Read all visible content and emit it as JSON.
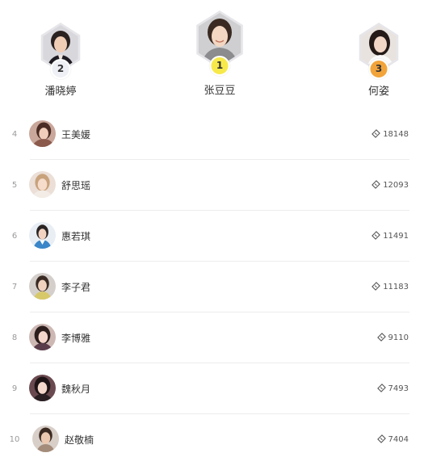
{
  "podium": [
    {
      "rank": "2",
      "name": "潘晓婷",
      "medal_color": "#eef0f6"
    },
    {
      "rank": "1",
      "name": "张豆豆",
      "medal_color": "#f7e94a"
    },
    {
      "rank": "3",
      "name": "何姿",
      "medal_color": "#f2a43a"
    }
  ],
  "ranking": [
    {
      "rank": "4",
      "name": "王美媛",
      "score": "18148"
    },
    {
      "rank": "5",
      "name": "舒思瑶",
      "score": "12093"
    },
    {
      "rank": "6",
      "name": "惠若琪",
      "score": "11491"
    },
    {
      "rank": "7",
      "name": "李子君",
      "score": "11183"
    },
    {
      "rank": "8",
      "name": "李博雅",
      "score": "9110"
    },
    {
      "rank": "9",
      "name": "魏秋月",
      "score": "7493"
    },
    {
      "rank": "10",
      "name": "赵敬楠",
      "score": "7404"
    }
  ],
  "icons": {
    "score_icon": "ticket-icon"
  },
  "colors": {
    "divider": "#ececec",
    "rank_text": "#9a9a9a"
  }
}
